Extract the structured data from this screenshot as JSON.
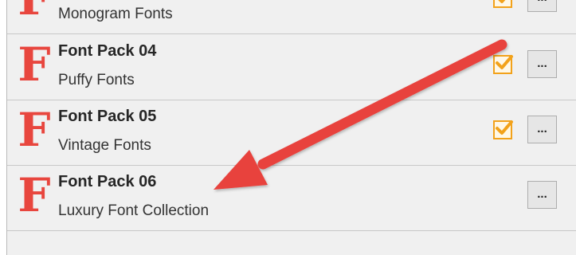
{
  "font_packs": [
    {
      "title": "",
      "subtitle": "Monogram Fonts",
      "logo": "F",
      "checked": true
    },
    {
      "title": "Font Pack 04",
      "subtitle": "Puffy Fonts",
      "logo": "F",
      "checked": true
    },
    {
      "title": "Font Pack 05",
      "subtitle": "Vintage Fonts",
      "logo": "F",
      "checked": true
    },
    {
      "title": "Font Pack 06",
      "subtitle": "Luxury Font Collection",
      "logo": "F",
      "checked": false
    }
  ],
  "more_button_label": "...",
  "colors": {
    "logo_red": "#e8463e",
    "checkbox_orange": "#f2a21b",
    "annotation_arrow": "#e8423e"
  },
  "icons": {
    "logo": "font-f-logo-icon",
    "checkbox": "checkmark-icon",
    "annotation": "red-arrow-icon"
  }
}
